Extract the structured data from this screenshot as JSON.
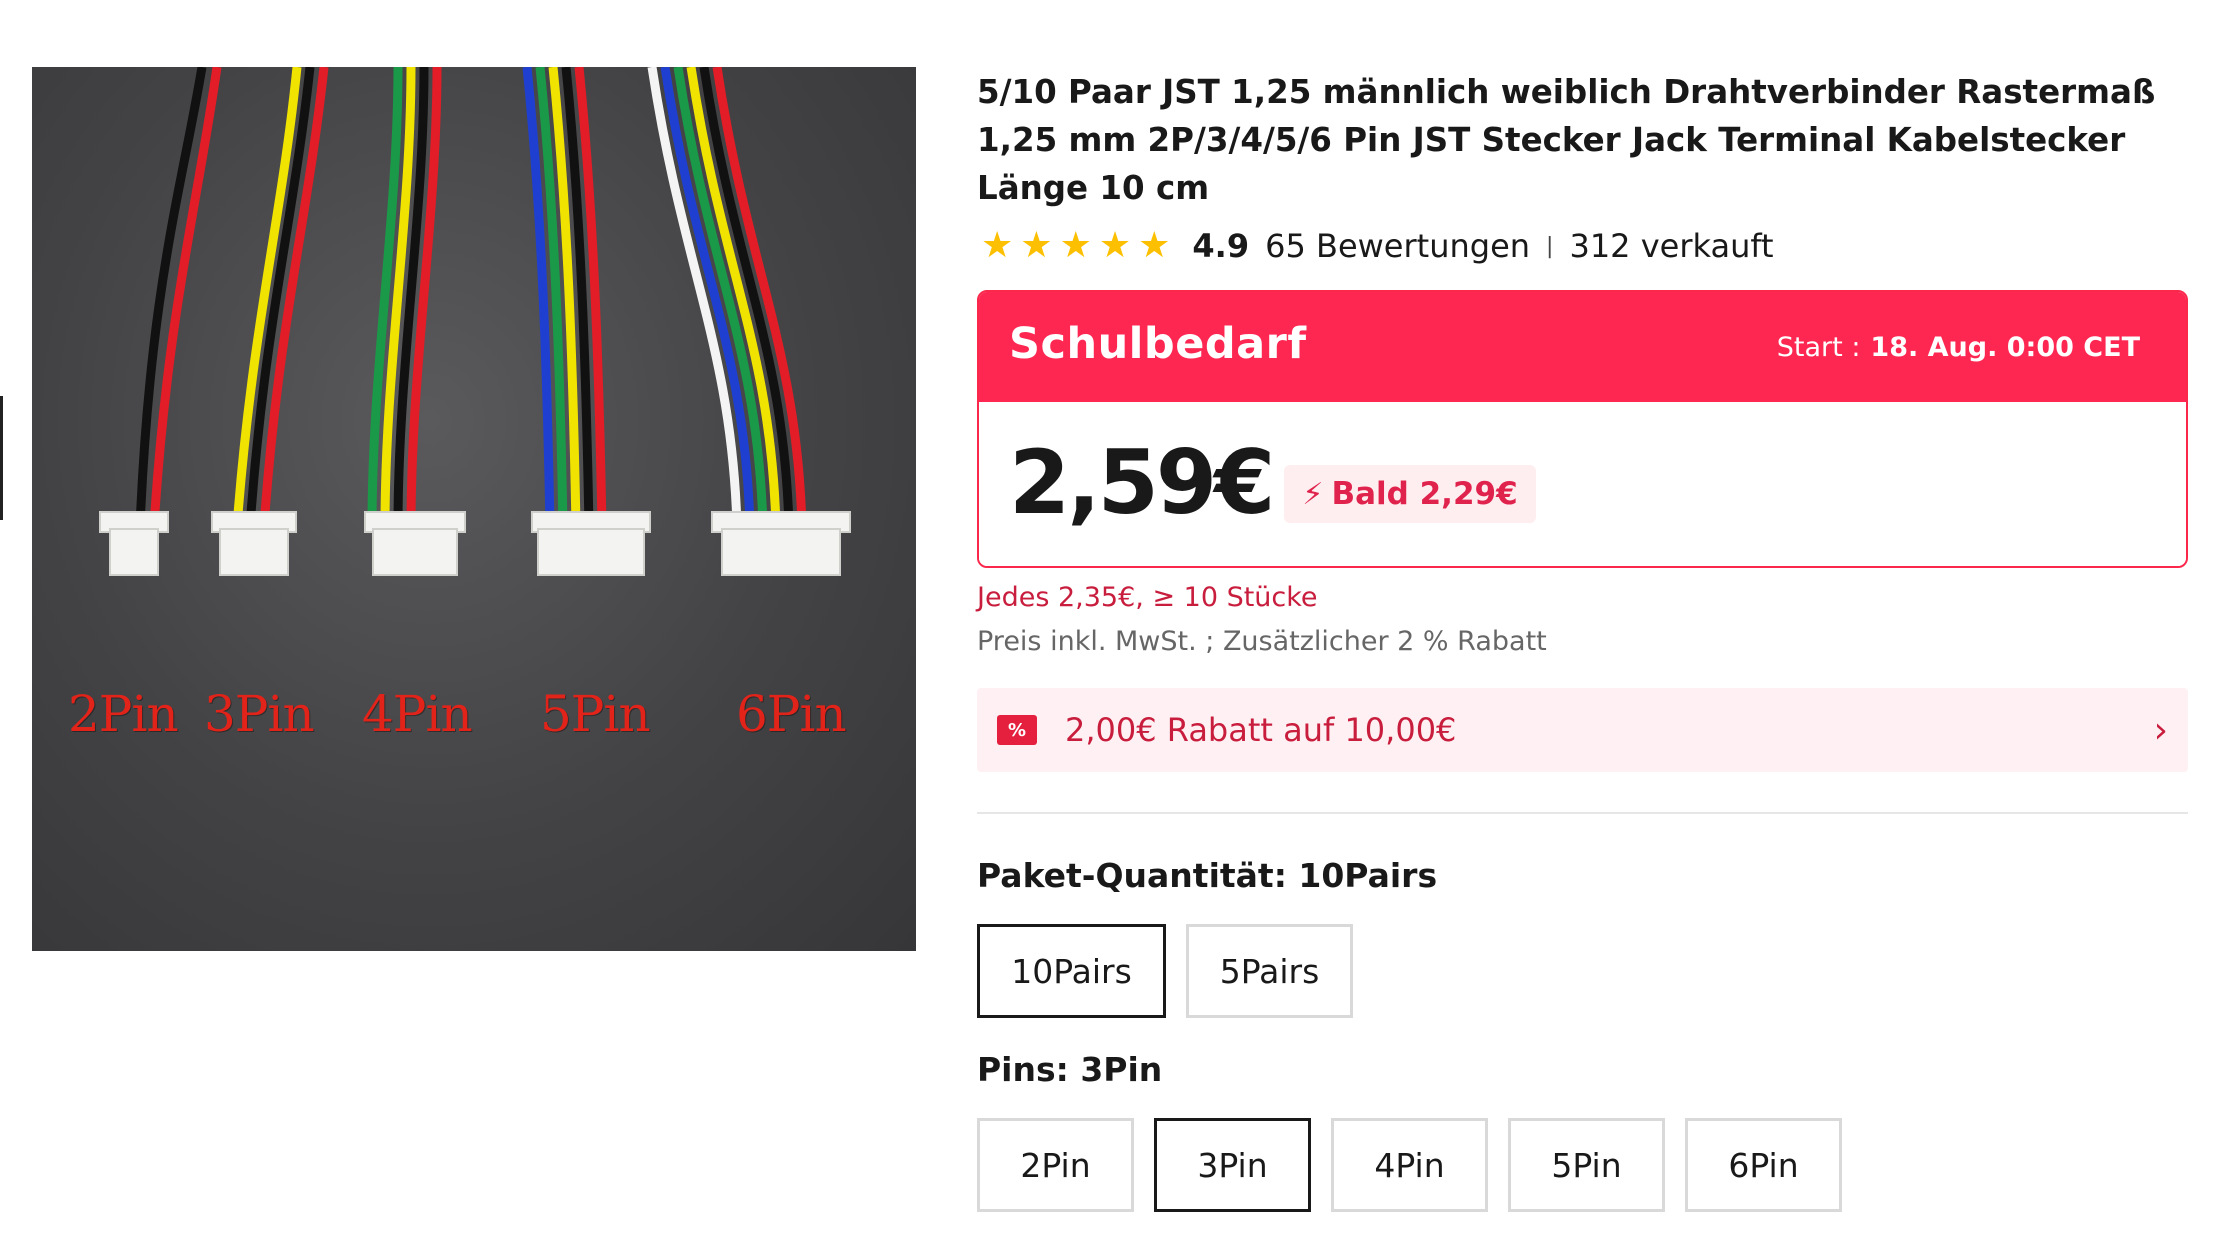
{
  "product": {
    "title": "5/10 Paar JST 1,25 männlich weiblich Drahtverbinder Rastermaß 1,25 mm 2P/3/4/5/6 Pin JST Stecker Jack Terminal Kabelstecker Länge 10 cm",
    "image_captions": [
      "2Pin",
      "3Pin",
      "4Pin",
      "5Pin",
      "6Pin"
    ],
    "rating": "4.9",
    "reviews": "65 Bewertungen",
    "separator": "|",
    "sold": "312 verkauft",
    "star_count": 5
  },
  "promo": {
    "name": "Schulbedarf",
    "start_label": "Start :",
    "start_value": "18. Aug. 0:00 CET",
    "price": "2,59€",
    "soon_label": "Bald 2,29€",
    "accent": "#fd2752"
  },
  "pricing": {
    "tier": "Jedes 2,35€, ≥ 10 Stücke",
    "tax_note": "Preis inkl. MwSt. ; Zusätzlicher 2 % Rabatt"
  },
  "coupon": {
    "icon": "%",
    "text": "2,00€ Rabatt auf 10,00€"
  },
  "options": {
    "quantity_label": "Paket-Quantität: 10Pairs",
    "quantity_choices": [
      "10Pairs",
      "5Pairs"
    ],
    "quantity_selected": "10Pairs",
    "pins_label": "Pins: 3Pin",
    "pins_choices": [
      "2Pin",
      "3Pin",
      "4Pin",
      "5Pin",
      "6Pin"
    ],
    "pins_selected": "3Pin"
  }
}
